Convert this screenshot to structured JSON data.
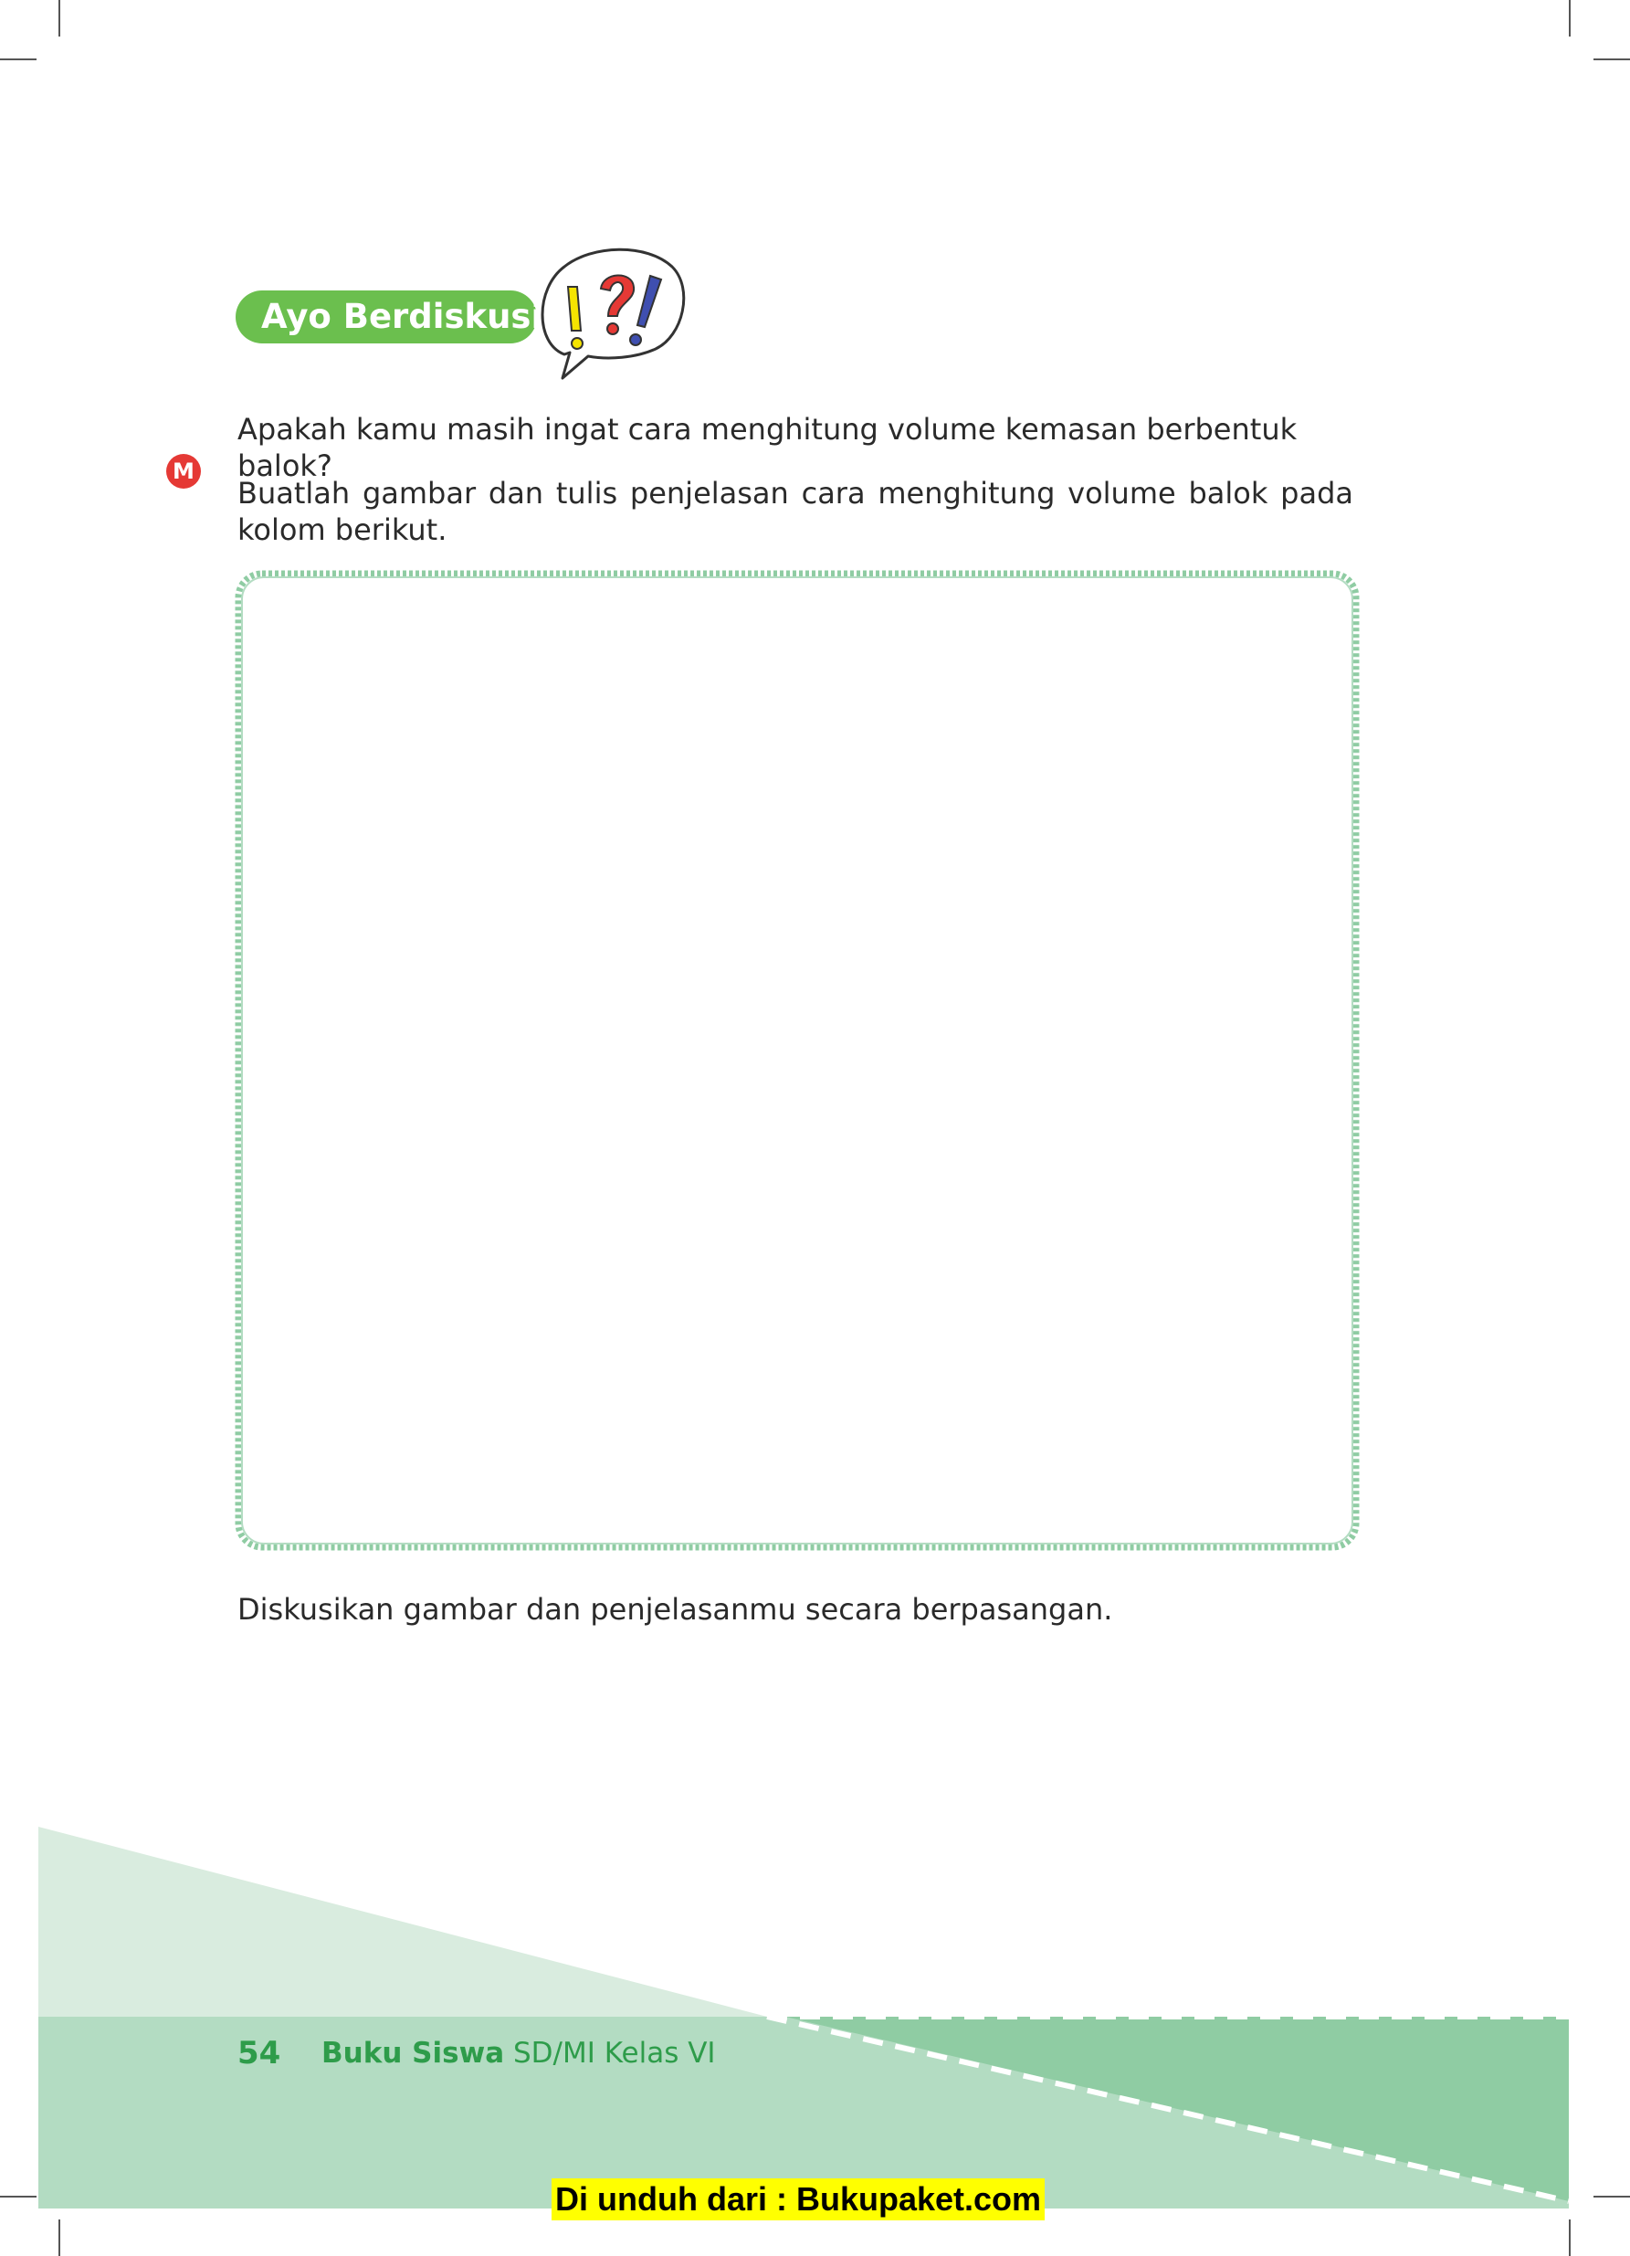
{
  "section": {
    "header_label": "Ayo Berdiskusi",
    "question_icon": "exclamation-question-bubble-icon"
  },
  "content": {
    "question": "Apakah kamu masih ingat cara menghitung volume kemasan berbentuk balok?",
    "instruction": "Buatlah gambar dan tulis penjelasan cara menghitung volume balok pada kolom berikut.",
    "marker_label": "M",
    "closing": "Diskusikan gambar dan penjelasanmu secara berpasangan."
  },
  "footer": {
    "page_number": "54",
    "book_title_bold": "Buku Siswa",
    "book_title_rest": "SD/MI Kelas VI",
    "download_note": "Di unduh dari : Bukupaket.com"
  },
  "colors": {
    "header_green": "#6bbf4e",
    "footer_light": "#d9ecdf",
    "footer_mid": "#b3dcc2",
    "footer_dark": "#8fcca3",
    "text_green": "#2e9c4a",
    "marker_red": "#e53935",
    "highlight_yellow": "#ffff00"
  }
}
